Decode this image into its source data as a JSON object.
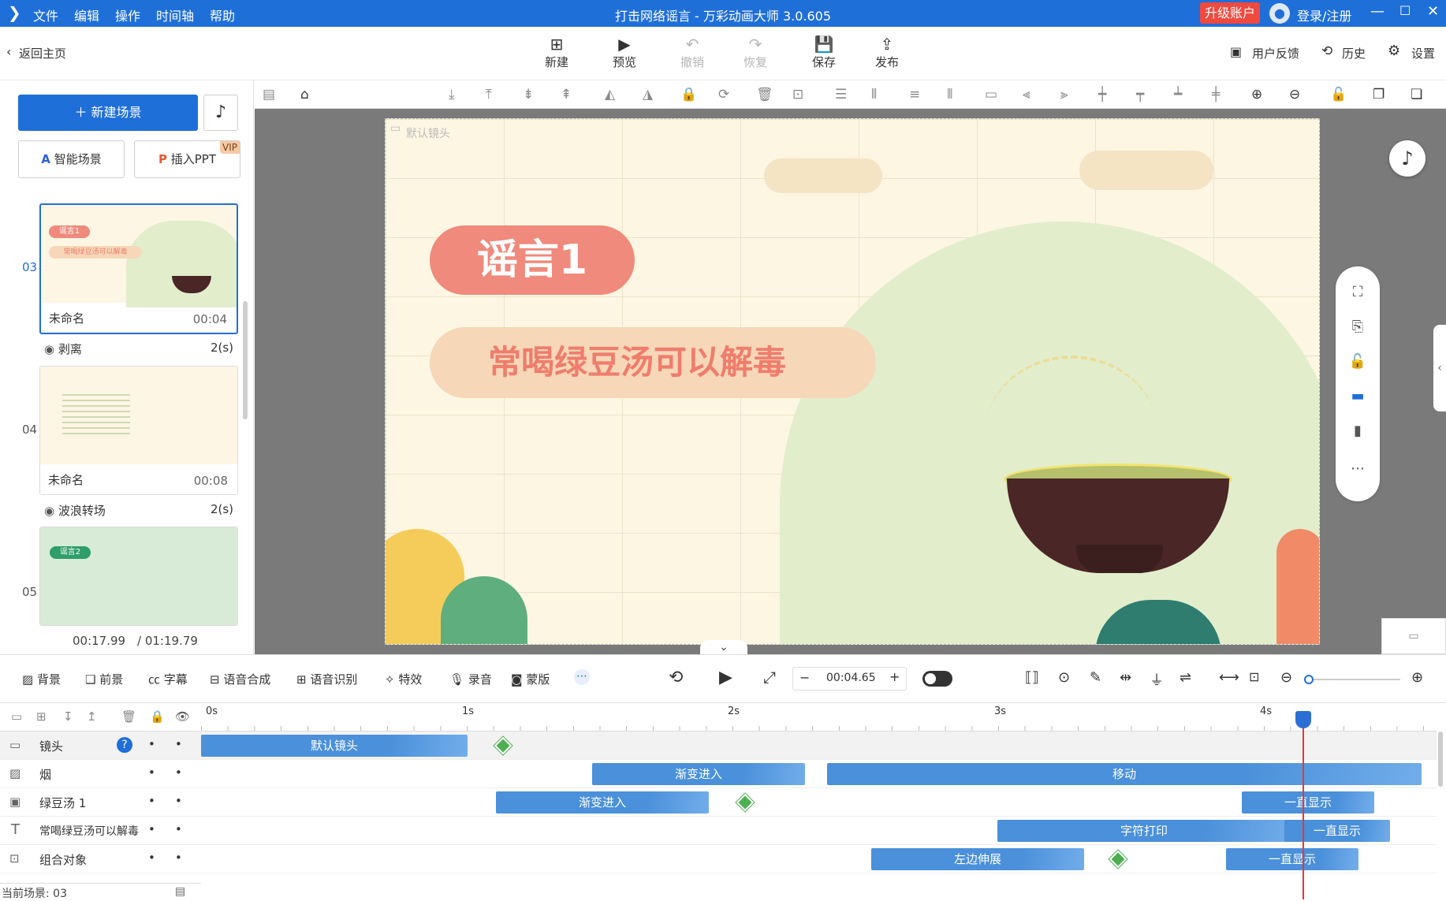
{
  "app": {
    "title": "打击网络谣言 - 万彩动画大师 3.0.605",
    "menus": [
      "文件",
      "编辑",
      "操作",
      "时间轴",
      "帮助"
    ],
    "upgrade": "升级账户",
    "login": "登录/注册"
  },
  "toolbar": {
    "back": "返回主页",
    "buttons": [
      {
        "label": "新建",
        "icon": "plus-square-icon",
        "enabled": true
      },
      {
        "label": "预览",
        "icon": "play-icon",
        "enabled": true
      },
      {
        "label": "撤销",
        "icon": "undo-icon",
        "enabled": false
      },
      {
        "label": "恢复",
        "icon": "redo-icon",
        "enabled": false
      },
      {
        "label": "保存",
        "icon": "save-icon",
        "enabled": true
      },
      {
        "label": "发布",
        "icon": "publish-icon",
        "enabled": true
      }
    ],
    "feedback": "用户反馈",
    "history": "历史",
    "settings": "设置"
  },
  "left": {
    "new_scene": "新建场景",
    "smart_scene": "智能场景",
    "insert_ppt": "插入PPT",
    "vip": "VIP",
    "scenes": [
      {
        "no": "03",
        "name": "未命名",
        "time": "00:04",
        "tag": "谣言1",
        "subtitle": "常喝绿豆汤可以解毒",
        "selected": true
      },
      {
        "no": "04",
        "name": "未命名",
        "time": "00:08"
      },
      {
        "no": "05",
        "tag": "谣言2"
      }
    ],
    "transitions": [
      {
        "name": "剥离",
        "dur": "2(s)"
      },
      {
        "name": "波浪转场",
        "dur": "2(s)"
      }
    ],
    "current_time": "00:17.99",
    "total_time": "/ 01:19.79"
  },
  "stage": {
    "camera_label": "默认镜头",
    "tag": "谣言1",
    "headline": "常喝绿豆汤可以解毒",
    "colors": {
      "tag_bg": "#ef8a7c",
      "headline_bg": "#f6d7b8",
      "headline_text": "#ef7d6c",
      "hill": "#e2edcc"
    }
  },
  "bottombar": {
    "items": [
      {
        "label": "背景",
        "icon": "background-icon"
      },
      {
        "label": "前景",
        "icon": "foreground-icon"
      },
      {
        "label": "字幕",
        "icon": "subtitle-icon"
      },
      {
        "label": "语音合成",
        "icon": "tts-icon"
      },
      {
        "label": "语音识别",
        "icon": "asr-icon"
      },
      {
        "label": "特效",
        "icon": "effects-icon"
      },
      {
        "label": "录音",
        "icon": "mic-icon"
      },
      {
        "label": "蒙版",
        "icon": "mask-icon"
      }
    ],
    "time": "00:04.65"
  },
  "timeline": {
    "ticks": [
      "0s",
      "1s",
      "2s",
      "3s",
      "4s"
    ],
    "tracks": [
      {
        "name": "镜头",
        "clips": [
          {
            "label": "默认镜头"
          }
        ]
      },
      {
        "name": "烟",
        "clips": [
          {
            "label": "渐变进入"
          },
          {
            "label": "移动"
          }
        ]
      },
      {
        "name": "绿豆汤 1",
        "clips": [
          {
            "label": "渐变进入"
          },
          {
            "label": "一直显示"
          }
        ]
      },
      {
        "name": "常喝绿豆汤可以解毒",
        "clips": [
          {
            "label": "字符打印"
          },
          {
            "label": "一直显示"
          }
        ]
      },
      {
        "name": "组合对象",
        "clips": [
          {
            "label": "左边伸展"
          },
          {
            "label": "一直显示"
          }
        ]
      }
    ],
    "current_scene": "当前场景: 03"
  }
}
